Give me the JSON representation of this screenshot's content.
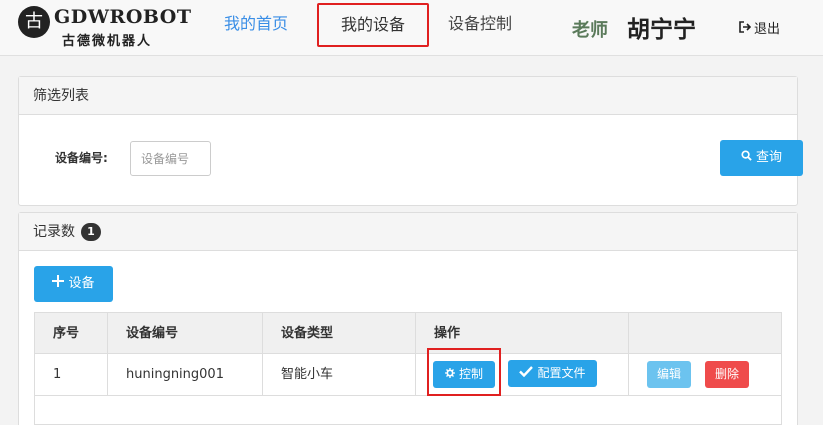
{
  "navbar": {
    "logo_badge": "古",
    "logo_text": "GDWROBOT",
    "logo_subtitle": "古德微机器人",
    "links": [
      {
        "label": "我的首页"
      },
      {
        "label": "我的设备"
      },
      {
        "label": "设备控制"
      }
    ],
    "role": "老师",
    "user_name": "胡宁宁",
    "logout_label": "退出",
    "logout_icon": "sign-out-icon"
  },
  "filter_panel": {
    "title": "筛选列表",
    "device_id_label": "设备编号:",
    "device_id_placeholder": "设备编号",
    "device_id_value": "",
    "query_label": "查询",
    "query_icon": "search-icon"
  },
  "records_panel": {
    "title": "记录数",
    "count": "1",
    "add_label": "设备",
    "add_icon": "plus-icon",
    "table": {
      "headers": [
        "序号",
        "设备编号",
        "设备类型",
        "操作",
        ""
      ],
      "rows": [
        {
          "index": "1",
          "device_id": "huningning001",
          "device_type": "智能小车",
          "control_label": "控制",
          "config_label": "配置文件",
          "edit_label": "编辑",
          "delete_label": "删除"
        }
      ]
    }
  },
  "colors": {
    "primary": "#29a3e8",
    "danger": "#ef4b4b",
    "info_light": "#6cc3ef",
    "highlight": "#e02020",
    "nav_active": "#3a8ee6"
  }
}
